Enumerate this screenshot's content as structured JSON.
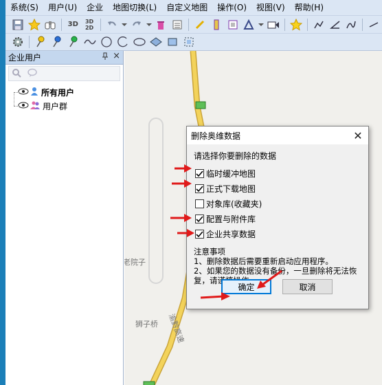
{
  "menu": [
    {
      "name": "menu-system",
      "label": "系统(S)"
    },
    {
      "name": "menu-user",
      "label": "用户(U)"
    },
    {
      "name": "menu-enterprise",
      "label": "企业"
    },
    {
      "name": "menu-map-switch",
      "label": "地图切换(L)"
    },
    {
      "name": "menu-custom-map",
      "label": "自定义地图"
    },
    {
      "name": "menu-operate",
      "label": "操作(O)"
    },
    {
      "name": "menu-view",
      "label": "视图(V)"
    },
    {
      "name": "menu-help",
      "label": "帮助(H)"
    }
  ],
  "toolbar": {
    "btn_3d": "3D",
    "btn_3d2d_top": "3D",
    "btn_3d2d_bottom": "2D"
  },
  "panel": {
    "title": "企业用户",
    "pin": "ᵖ",
    "close": "×",
    "tree": [
      {
        "label": "所有用户",
        "bold": true
      },
      {
        "label": "用户群",
        "bold": false
      }
    ]
  },
  "map": {
    "labels": [
      {
        "name": "map-label-laoyuanzi",
        "text": "老院子"
      },
      {
        "name": "map-label-shiziqiao",
        "text": "狮子桥"
      },
      {
        "name": "map-label-highway",
        "text": "渝黔高速"
      }
    ]
  },
  "dialog": {
    "title": "删除奥维数据",
    "close": "✕",
    "prompt": "请选择你要删除的数据",
    "options": [
      {
        "label": "临时缓冲地图",
        "checked": true
      },
      {
        "label": "正式下载地图",
        "checked": true
      },
      {
        "label": "对象库(收藏夹)",
        "checked": false
      },
      {
        "label": "配置与附件库",
        "checked": true
      },
      {
        "label": "企业共享数据",
        "checked": true
      }
    ],
    "notes_title": "注意事项",
    "note1": "1、删除数据后需要重新启动应用程序。",
    "note2": "2、如果您的数据没有备份，一旦删除将无法恢复，请谨慎操作。",
    "ok_label": "确定",
    "cancel_label": "取消"
  },
  "colors": {
    "accent": "#0078d7",
    "arrow": "#e01a1a",
    "road": "#f3d35b",
    "toolbar_bg": "#dbe6f4"
  }
}
